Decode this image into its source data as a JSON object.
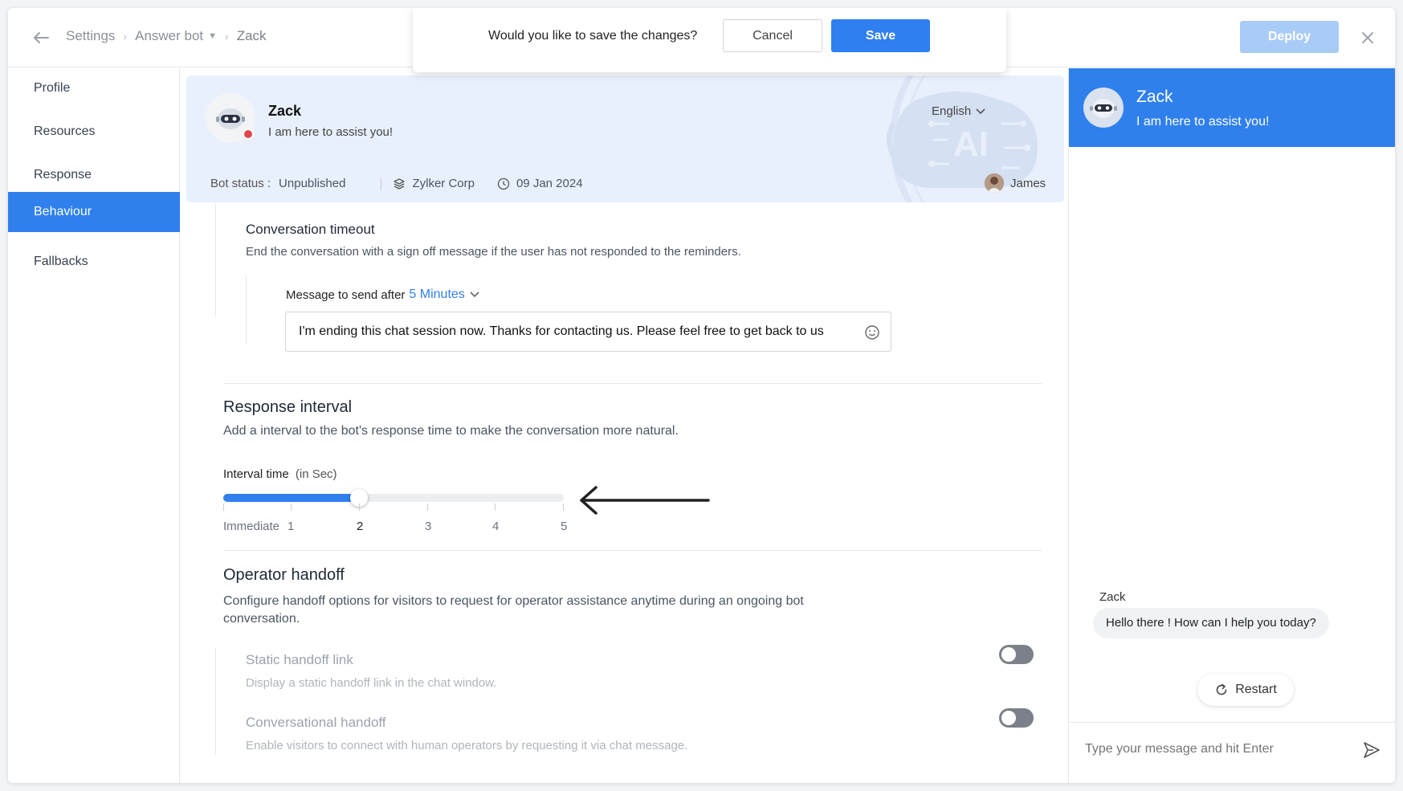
{
  "header": {
    "breadcrumbs": [
      "Settings",
      "Answer bot",
      "Zack"
    ],
    "deploy_label": "Deploy"
  },
  "save_dialog": {
    "question": "Would you like to save the changes?",
    "cancel_label": "Cancel",
    "save_label": "Save"
  },
  "sidebar": {
    "items": [
      {
        "label": "Profile"
      },
      {
        "label": "Resources"
      },
      {
        "label": "Response"
      },
      {
        "label": "Behaviour"
      },
      {
        "label": "Fallbacks"
      }
    ],
    "active": "Behaviour"
  },
  "bot": {
    "name": "Zack",
    "tagline": "I am here to assist you!",
    "language": "English",
    "status_label": "Bot status :",
    "status_value": "Unpublished",
    "company": "Zylker Corp",
    "date": "09 Jan 2024",
    "owner": "James"
  },
  "timeout": {
    "title": "Conversation timeout",
    "description": "End the conversation with a sign off message if the user has not responded to the reminders.",
    "message_label": "Message to send after",
    "duration": "5 Minutes",
    "message": "I'm ending this chat session now. Thanks for contacting us. Please feel free to get back to us"
  },
  "response_interval": {
    "title": "Response interval",
    "description": "Add a interval to the bot's response time to make the conversation more natural.",
    "interval_label": "Interval time",
    "interval_unit": "(in Sec)",
    "ticks": [
      "Immediate",
      "1",
      "2",
      "3",
      "4",
      "5"
    ],
    "value": 2,
    "max": 5
  },
  "handoff": {
    "title": "Operator handoff",
    "description_line1": "Configure handoff options for visitors to request for operator assistance anytime during an ongoing bot",
    "description_line2": "conversation.",
    "options": [
      {
        "title": "Static handoff link",
        "desc": "Display a static handoff link in the chat window.",
        "enabled": false
      },
      {
        "title": "Conversational handoff",
        "desc": "Enable visitors to connect with human operators by requesting it via chat message.",
        "enabled": false
      }
    ]
  },
  "chat_preview": {
    "bot_name": "Zack",
    "tagline": "I am here to assist you!",
    "sender": "Zack",
    "message": "Hello there ! How can I help you today?",
    "restart_label": "Restart",
    "input_placeholder": "Type your message and hit Enter"
  },
  "colors": {
    "accent": "#2f80ed",
    "card_bg": "#e8f0fd",
    "deploy_disabled": "#a9ccf7",
    "status_dot": "#e0474c"
  }
}
